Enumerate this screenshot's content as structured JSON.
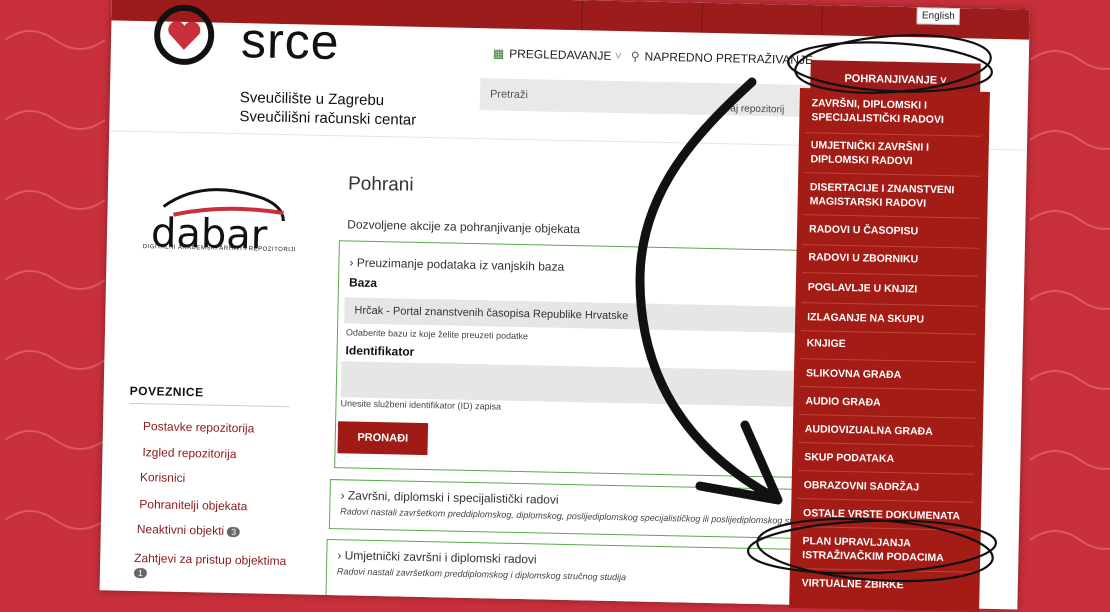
{
  "header": {
    "lang_label": "English",
    "brand": "srce",
    "brand_sub_1": "Sveučilište u Zagrebu",
    "brand_sub_2": "Sveučilišni računski centar"
  },
  "nav": {
    "browse": "PREGLEDAVANJE",
    "advanced": "NAPREDNO PRETRAŽIVANJE",
    "deposit": "POHRANJIVANJE"
  },
  "search": {
    "placeholder": "Pretraži",
    "scope": "ovaj repozitorij"
  },
  "sidebar": {
    "logo_text": "dabar",
    "logo_tagline": "DIGITALNI AKADEMSKI ARHIVI I REPOZITORIJI",
    "section_title": "POVEZNICE",
    "links": [
      {
        "label": "Postavke repozitorija"
      },
      {
        "label": "Izgled repozitorija"
      },
      {
        "label": "Korisnici"
      },
      {
        "label": "Pohranitelji objekata"
      },
      {
        "label": "Neaktivni objekti",
        "badge": "3"
      },
      {
        "label": "Zahtjevi za pristup objektima",
        "badge": "1"
      }
    ]
  },
  "main": {
    "title": "Pohrani",
    "subtitle": "Dozvoljene akcije za pohranjivanje objekata",
    "import_panel": {
      "title": "Preuzimanje podataka iz vanjskih baza",
      "base_label": "Baza",
      "base_value": "Hrčak - Portal znanstvenih časopisa Republike Hrvatske",
      "base_help": "Odaberite bazu iz koje želite preuzeti podatke",
      "id_label": "Identifikator",
      "id_help": "Unesite službeni identifikator (ID) zapisa",
      "find_button": "PRONAĐI"
    },
    "panels": [
      {
        "title": "Završni, diplomski i specijalistički radovi",
        "desc": "Radovi nastali završetkom preddiplomskog, diplomskog, poslijediplomskog specijalističkog ili poslijediplomskog stručnog"
      },
      {
        "title": "Umjetnički završni i diplomski radovi",
        "desc": "Radovi nastali završetkom preddiplomskog i diplomskog stručnog studija"
      }
    ]
  },
  "dropdown": {
    "items": [
      "ZAVRŠNI, DIPLOMSKI I SPECIJALISTIČKI RADOVI",
      "UMJETNIČKI ZAVRŠNI I DIPLOMSKI RADOVI",
      "DISERTACIJE I ZNANSTVENI MAGISTARSKI RADOVI",
      "RADOVI U ČASOPISU",
      "RADOVI U ZBORNIKU",
      "POGLAVLJE U KNJIZI",
      "IZLAGANJE NA SKUPU",
      "KNJIGE",
      "SLIKOVNA GRAĐA",
      "AUDIO GRAĐA",
      "AUDIOVIZUALNA GRAĐA",
      "SKUP PODATAKA",
      "OBRAZOVNI SADRŽAJ",
      "OSTALE VRSTE DOKUMENATA",
      "PLAN UPRAVLJANJA ISTRAŽIVAČKIM PODACIMA",
      "VIRTUALNE ZBIRKE"
    ]
  },
  "colors": {
    "background": "#c8303b",
    "brand_red": "#9b1c1a",
    "panel_border": "#5aa84e"
  }
}
